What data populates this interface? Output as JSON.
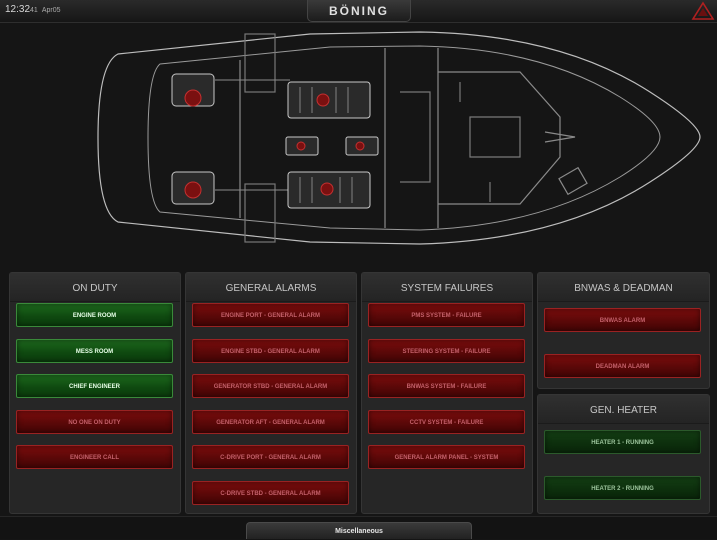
{
  "header": {
    "time": "12:32",
    "seconds": "41",
    "date": "Apr05",
    "logo": "BÖNING",
    "warning_icon": "warning-triangle-icon"
  },
  "panels": {
    "on_duty": {
      "title": "ON DUTY",
      "buttons": [
        {
          "label": "ENGINE ROOM",
          "state": "green"
        },
        {
          "label": "MESS ROOM",
          "state": "green"
        },
        {
          "label": "CHIEF ENGINEER",
          "state": "green"
        },
        {
          "label": "NO ONE ON DUTY",
          "state": "red"
        },
        {
          "label": "ENGINEER CALL",
          "state": "red"
        }
      ]
    },
    "general_alarms": {
      "title": "GENERAL ALARMS",
      "buttons": [
        {
          "label": "ENGINE PORT - GENERAL ALARM",
          "state": "red"
        },
        {
          "label": "ENGINE STBD - GENERAL ALARM",
          "state": "red"
        },
        {
          "label": "GENERATOR STBD - GENERAL ALARM",
          "state": "red"
        },
        {
          "label": "GENERATOR AFT - GENERAL ALARM",
          "state": "red"
        },
        {
          "label": "C-DRIVE PORT - GENERAL ALARM",
          "state": "red"
        },
        {
          "label": "C-DRIVE STBD - GENERAL ALARM",
          "state": "red"
        }
      ]
    },
    "system_failures": {
      "title": "SYSTEM FAILURES",
      "buttons": [
        {
          "label": "PMS SYSTEM - FAILURE",
          "state": "red"
        },
        {
          "label": "STEERING SYSTEM - FAILURE",
          "state": "red"
        },
        {
          "label": "BNWAS SYSTEM - FAILURE",
          "state": "red"
        },
        {
          "label": "CCTV SYSTEM - FAILURE",
          "state": "red"
        },
        {
          "label": "GENERAL ALARM PANEL - SYSTEM",
          "state": "red"
        }
      ]
    },
    "bnwas": {
      "title": "BNWAS & DEADMAN",
      "buttons": [
        {
          "label": "BNWAS ALARM",
          "state": "red"
        },
        {
          "label": "DEADMAN ALARM",
          "state": "red"
        }
      ]
    },
    "gen_heater": {
      "title": "GEN. HEATER",
      "buttons": [
        {
          "label": "HEATER 1 - RUNNING",
          "state": "darkgreen"
        },
        {
          "label": "HEATER 2 - RUNNING",
          "state": "darkgreen"
        }
      ]
    }
  },
  "footer": {
    "tab_label": "Miscellaneous"
  },
  "colors": {
    "running_green": "#0f4a10",
    "alarm_red": "#5a0808",
    "background": "#151515"
  }
}
